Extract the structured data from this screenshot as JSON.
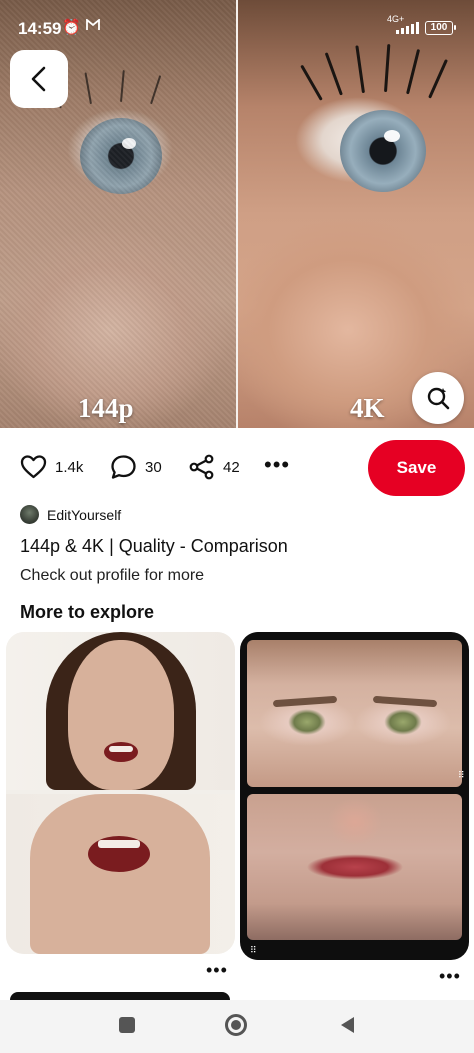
{
  "status_bar": {
    "time": "14:59",
    "alarm_icon": "alarm-clock-icon",
    "mail_icon": "gmail-icon",
    "network": "4G+",
    "battery": "100"
  },
  "hero": {
    "left_caption": "144p",
    "right_caption": "4K",
    "back_icon": "chevron-left-icon",
    "lens_icon": "visual-search-icon"
  },
  "actions": {
    "like_count": "1.4k",
    "comment_count": "30",
    "share_count": "42",
    "more_label": "•••",
    "save_label": "Save"
  },
  "pin": {
    "creator": "EditYourself",
    "title": "144p & 4K | Quality - Comparison",
    "description": "Check out profile for more"
  },
  "explore": {
    "heading": "More to explore",
    "card_more_label": "•••",
    "card_icon": "⠿"
  },
  "colors": {
    "save_button": "#e60023",
    "nav_bar": "#f4f4f4"
  }
}
